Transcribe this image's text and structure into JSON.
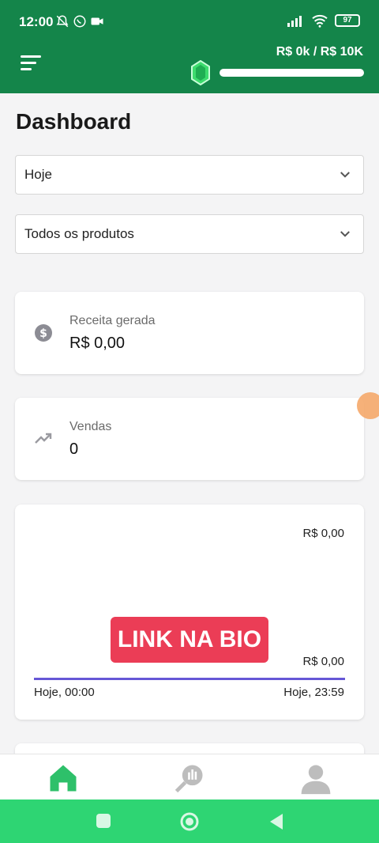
{
  "status_bar": {
    "time": "12:00",
    "battery": "97"
  },
  "header": {
    "goal_text": "R$ 0k / R$ 10K",
    "goal_progress": 0.0
  },
  "page": {
    "title": "Dashboard"
  },
  "filters": {
    "period": "Hoje",
    "products": "Todos os produtos"
  },
  "cards": {
    "revenue": {
      "label": "Receita gerada",
      "value": "R$ 0,00",
      "icon": "dollar-coin-icon"
    },
    "sales": {
      "label": "Vendas",
      "value": "0",
      "icon": "trending-up-icon"
    }
  },
  "chart": {
    "top_value": "R$ 0,00",
    "bottom_value": "R$ 0,00",
    "x_start": "Hoje, 00:00",
    "x_end": "Hoje, 23:59",
    "overlay_badge": "LINK NA BIO",
    "line_color": "#6657d6"
  },
  "nav": {
    "items": [
      "home-icon",
      "analytics-search-icon",
      "profile-icon"
    ]
  },
  "colors": {
    "header": "#14854a",
    "accent": "#2ed573",
    "badge": "#eb3d56"
  }
}
